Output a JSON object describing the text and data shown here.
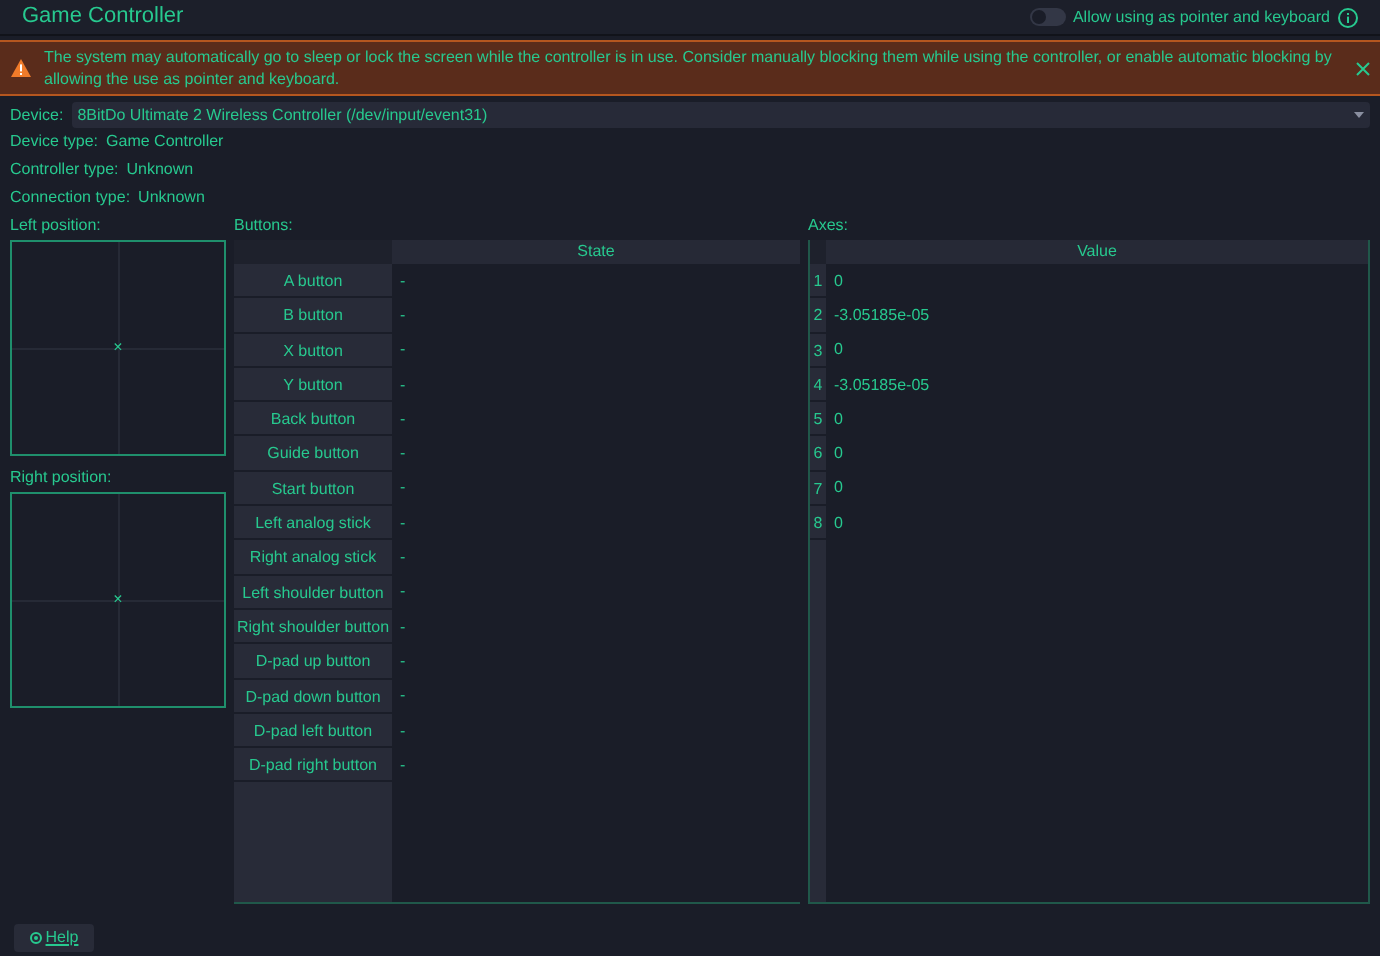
{
  "window": {
    "title": "Game Controller"
  },
  "pointer_toggle": {
    "label": "Allow using as pointer and keyboard",
    "on": false
  },
  "warning": {
    "text": "The system may automatically go to sleep or lock the screen while the controller is in use. Consider manually blocking them while using the controller, or enable automatic blocking by allowing the use as pointer and keyboard."
  },
  "device": {
    "label": "Device:",
    "value": "8BitDo Ultimate 2 Wireless Controller (/dev/input/event31)"
  },
  "info": [
    {
      "label": "Device type:",
      "value": "Game Controller"
    },
    {
      "label": "Controller type:",
      "value": "Unknown"
    },
    {
      "label": "Connection type:",
      "value": "Unknown"
    }
  ],
  "left_position": {
    "label": "Left position:",
    "marker": "×"
  },
  "right_position": {
    "label": "Right position:",
    "marker": "×"
  },
  "buttons": {
    "label": "Buttons:",
    "column": "State",
    "rows": [
      {
        "name": "A button",
        "state": "-"
      },
      {
        "name": "B button",
        "state": "-"
      },
      {
        "name": "X button",
        "state": "-"
      },
      {
        "name": "Y button",
        "state": "-"
      },
      {
        "name": "Back button",
        "state": "-"
      },
      {
        "name": "Guide button",
        "state": "-"
      },
      {
        "name": "Start button",
        "state": "-"
      },
      {
        "name": "Left analog stick",
        "state": "-"
      },
      {
        "name": "Right analog stick",
        "state": "-"
      },
      {
        "name": "Left shoulder button",
        "state": "-"
      },
      {
        "name": "Right shoulder button",
        "state": "-"
      },
      {
        "name": "D-pad up button",
        "state": "-"
      },
      {
        "name": "D-pad down button",
        "state": "-"
      },
      {
        "name": "D-pad left button",
        "state": "-"
      },
      {
        "name": "D-pad right button",
        "state": "-"
      }
    ]
  },
  "axes": {
    "label": "Axes:",
    "column": "Value",
    "rows": [
      {
        "index": "1",
        "value": "0"
      },
      {
        "index": "2",
        "value": "-3.05185e-05"
      },
      {
        "index": "3",
        "value": "0"
      },
      {
        "index": "4",
        "value": "-3.05185e-05"
      },
      {
        "index": "5",
        "value": "0"
      },
      {
        "index": "6",
        "value": "0"
      },
      {
        "index": "7",
        "value": "0"
      },
      {
        "index": "8",
        "value": "0"
      }
    ]
  },
  "help_button": {
    "label": "Help"
  }
}
